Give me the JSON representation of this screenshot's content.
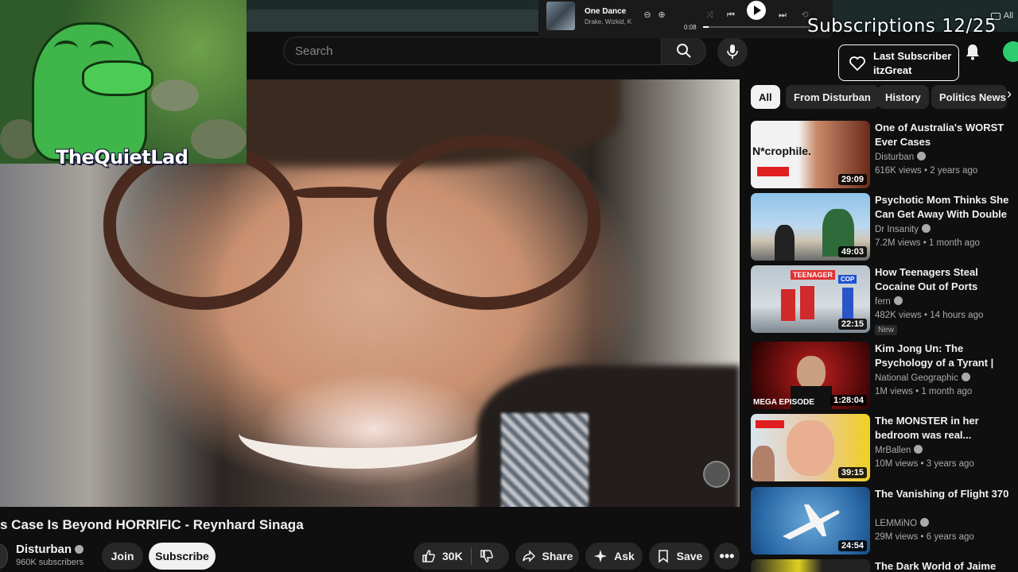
{
  "browser": {
    "bookmark_label": "All"
  },
  "music": {
    "title": "One Dance",
    "artist": "Drake, Wizkid, K",
    "time": "0:08",
    "progress": 0.05
  },
  "overlay": {
    "subs_goal": "Subscriptions 12/25",
    "last_sub_label": "Last Subscriber",
    "last_sub_name": "itzGreat",
    "streamer_name": "TheQuietLad"
  },
  "search": {
    "placeholder": "Search"
  },
  "video": {
    "title": "s Case Is Beyond HORRIFIC - Reynhard Sinaga",
    "channel": "Disturban",
    "subscribers": "960K subscribers",
    "join_label": "Join",
    "subscribe_label": "Subscribe",
    "likes": "30K",
    "share_label": "Share",
    "ask_label": "Ask",
    "save_label": "Save"
  },
  "chips": [
    "All",
    "From Disturban",
    "History",
    "Politics News"
  ],
  "recommendations": [
    {
      "title": "One of Australia's WORST Ever Cases",
      "channel": "Disturban",
      "verified": true,
      "meta": "616K views • 2 years ago",
      "duration": "29:09",
      "thumb_text": "N*crophile.",
      "badge": ""
    },
    {
      "title": "Psychotic Mom Thinks She Can Get Away With Double Murder",
      "channel": "Dr Insanity",
      "verified": true,
      "meta": "7.2M views • 1 month ago",
      "duration": "49:03",
      "thumb_text": "",
      "badge": ""
    },
    {
      "title": "How Teenagers Steal Cocaine Out of Ports",
      "channel": "fern",
      "verified": true,
      "meta": "482K views • 14 hours ago",
      "duration": "22:15",
      "thumb_text": "TEENAGER",
      "thumb_text2": "COP",
      "badge": "New"
    },
    {
      "title": "Kim Jong Un: The Psychology of a Tyrant | North Korea: Insid…",
      "channel": "National Geographic",
      "verified": true,
      "meta": "1M views • 1 month ago",
      "duration": "1:28:04",
      "thumb_text": "MEGA EPISODE",
      "badge": ""
    },
    {
      "title": "The MONSTER in her bedroom was real... (*MATURE …",
      "channel": "MrBallen",
      "verified": true,
      "meta": "10M views • 3 years ago",
      "duration": "39:15",
      "thumb_text": "",
      "badge": ""
    },
    {
      "title": "The Vanishing of Flight 370",
      "channel": "LEMMiNO",
      "verified": true,
      "meta": "29M views • 6 years ago",
      "duration": "24:54",
      "thumb_text": "",
      "badge": ""
    },
    {
      "title": "The Dark World of Jaime Osuna",
      "channel": "",
      "verified": false,
      "meta": "",
      "duration": "",
      "thumb_text": "",
      "badge": ""
    }
  ]
}
